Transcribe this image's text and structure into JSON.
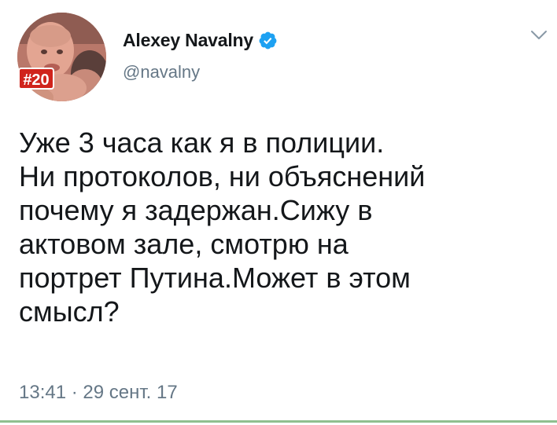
{
  "account": {
    "display_name": "Alexey Navalny",
    "handle": "@navalny",
    "avatar_badge": "#20",
    "verified": true
  },
  "tweet": {
    "text": "Уже 3 часа как я в полиции.\nНи протоколов, ни объяснений\nпочему я задержан.Сижу в\nактовом зале, смотрю на\nпортрет Путина.Может в этом\nсмысл?",
    "timestamp": "13:41 · 29 сент. 17"
  },
  "icons": {
    "verified": "verified-badge-icon",
    "menu": "chevron-down-icon"
  },
  "colors": {
    "text_primary": "#14171a",
    "text_secondary": "#657786",
    "verified_blue": "#1da1f2",
    "badge_red": "#d0241c"
  }
}
